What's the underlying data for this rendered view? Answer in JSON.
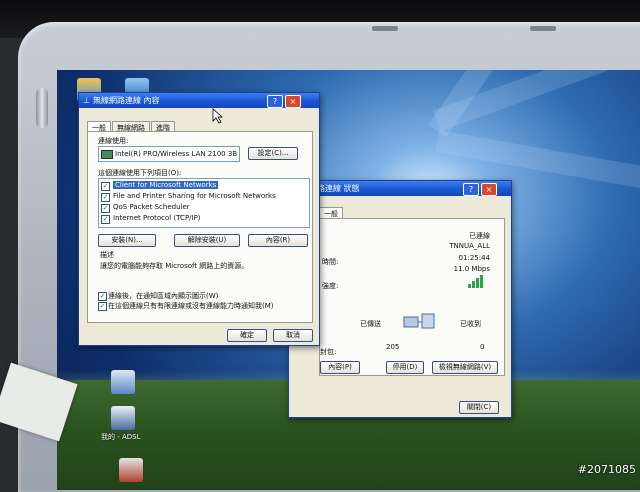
{
  "props_window": {
    "title": "無線網路連線 內容",
    "tabs": [
      "一般",
      "無線網路",
      "進階"
    ],
    "connect_using_label": "連線使用:",
    "adapter_name": "Intel(R) PRO/Wireless LAN 2100 3B",
    "configure_label": "設定(C)...",
    "items_label": "這個連線使用下列項目(O):",
    "items": [
      "Client for Microsoft Networks",
      "File and Printer Sharing for Microsoft Networks",
      "QoS Packet Scheduler",
      "Internet Protocol (TCP/IP)"
    ],
    "install_label": "安裝(N)...",
    "uninstall_label": "解除安裝(U)",
    "properties_label": "內容(R)",
    "description_label": "描述",
    "description_text": "讓您的電腦能夠存取 Microsoft 網路上的資源。",
    "option1": "連線後，在通知區域內顯示圖示(W)",
    "option2": "在這個連線只有有限連線或沒有連線能力時通知我(M)",
    "ok_label": "確定",
    "cancel_label": "取消"
  },
  "status_window": {
    "title": "無線網路連線 狀態",
    "tab": "一般",
    "status_value": "已連線",
    "ssid_value": "TNNUA_ALL",
    "duration_label": "時間:",
    "duration_value": "01:25:44",
    "speed_value": "11.0 Mbps",
    "signal_label": "強度:",
    "sent_label": "已傳送",
    "received_label": "已收到",
    "packets_label": "封包:",
    "sent_value": "205",
    "received_value": "0",
    "properties_label": "內容(P)",
    "disable_label": "停用(D)",
    "view_networks_label": "檢視無線網路(V)",
    "close_label": "關閉(C)"
  },
  "desktop": {
    "icon_label": "我的 - ADSL"
  },
  "watermark": "#2071085"
}
